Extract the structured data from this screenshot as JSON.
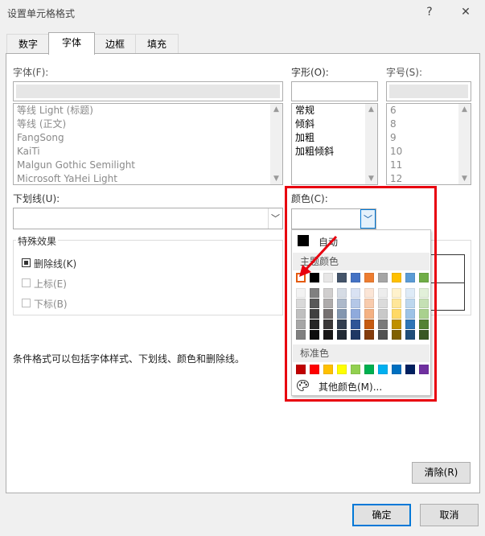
{
  "window": {
    "title": "设置单元格格式",
    "help_label": "?",
    "close_label": "✕"
  },
  "tabs": [
    {
      "label": "数字"
    },
    {
      "label": "字体"
    },
    {
      "label": "边框"
    },
    {
      "label": "填充"
    }
  ],
  "font": {
    "label": "字体(F):",
    "value": "",
    "items": [
      "等线 Light (标题)",
      "等线 (正文)",
      "FangSong",
      "KaiTi",
      "Malgun Gothic Semilight",
      "Microsoft YaHei Light"
    ]
  },
  "style": {
    "label": "字形(O):",
    "value": "",
    "items": [
      "常规",
      "倾斜",
      "加粗",
      "加粗倾斜"
    ]
  },
  "size": {
    "label": "字号(S):",
    "value": "",
    "items": [
      "6",
      "8",
      "9",
      "10",
      "11",
      "12"
    ]
  },
  "underline": {
    "label": "下划线(U):",
    "value": ""
  },
  "color": {
    "label": "颜色(C):",
    "value": ""
  },
  "effects": {
    "label": "特殊效果",
    "strikethrough": {
      "label": "删除线(K)",
      "checked": true
    },
    "superscript": {
      "label": "上标(E)",
      "checked": false
    },
    "subscript": {
      "label": "下标(B)",
      "checked": false
    }
  },
  "note": "条件格式可以包括字体样式、下划线、颜色和删除线。",
  "buttons": {
    "clear": "清除(R)",
    "ok": "确定",
    "cancel": "取消"
  },
  "color_popup": {
    "auto_label": "自动",
    "theme_label": "主题颜色",
    "standard_label": "标准色",
    "more_label": "其他颜色(M)...",
    "theme_top": [
      "#ffffff",
      "#000000",
      "#e7e6e6",
      "#44546a",
      "#4472c4",
      "#ed7d31",
      "#a5a5a5",
      "#ffc000",
      "#5b9bd5",
      "#70ad47"
    ],
    "theme_shades": [
      [
        "#f2f2f2",
        "#808080",
        "#d0cece",
        "#d6dce5",
        "#d9e2f3",
        "#fbe5d6",
        "#ededed",
        "#fff2cc",
        "#deebf7",
        "#e2f0d9"
      ],
      [
        "#d9d9d9",
        "#595959",
        "#aeabab",
        "#adb9ca",
        "#b4c7e7",
        "#f8cbad",
        "#dbdbdb",
        "#ffe699",
        "#bdd7ee",
        "#c5e0b4"
      ],
      [
        "#bfbfbf",
        "#404040",
        "#757070",
        "#8497b0",
        "#8faadc",
        "#f4b183",
        "#c9c9c9",
        "#ffd966",
        "#9dc3e6",
        "#a9d18e"
      ],
      [
        "#a6a6a6",
        "#262626",
        "#3b3838",
        "#333f50",
        "#2f5597",
        "#c55a11",
        "#7b7b7b",
        "#bf9000",
        "#2e75b6",
        "#548235"
      ],
      [
        "#808080",
        "#0d0d0d",
        "#181717",
        "#222a35",
        "#1f3864",
        "#843c0c",
        "#525252",
        "#7f6000",
        "#1f4e79",
        "#385723"
      ]
    ],
    "standard": [
      "#c00000",
      "#ff0000",
      "#ffc000",
      "#ffff00",
      "#92d050",
      "#00b050",
      "#00b0f0",
      "#0070c0",
      "#002060",
      "#7030a0"
    ]
  }
}
